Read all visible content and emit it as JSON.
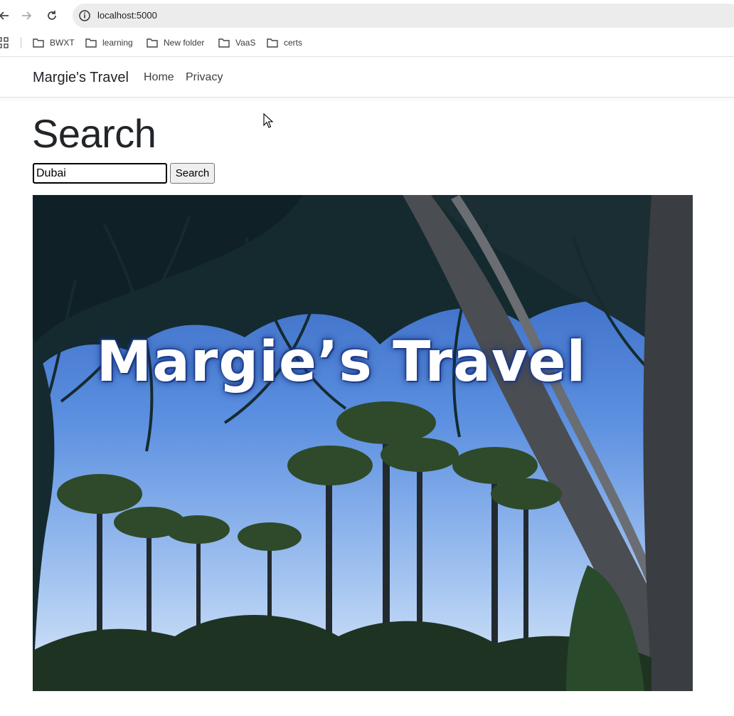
{
  "browser": {
    "url": "localhost:5000",
    "icons": {
      "back": "arrow-left-icon",
      "forward": "arrow-right-icon",
      "reload": "reload-icon",
      "site_info": "info-icon",
      "apps": "apps-grid-icon",
      "folder": "folder-icon"
    },
    "bookmarks": [
      {
        "label": "BWXT"
      },
      {
        "label": "learning"
      },
      {
        "label": "New folder"
      },
      {
        "label": "VaaS"
      },
      {
        "label": "certs"
      }
    ]
  },
  "site": {
    "brand": "Margie's Travel",
    "nav": [
      {
        "label": "Home"
      },
      {
        "label": "Privacy"
      }
    ]
  },
  "main": {
    "title": "Search",
    "search_value": "Dubai",
    "search_button": "Search"
  },
  "hero": {
    "overlay_text": "Margie’s Travel"
  },
  "colors": {
    "address_bar": "#ececed",
    "sky": "#3e6fc6",
    "navbar_border": "#dee2e6"
  }
}
